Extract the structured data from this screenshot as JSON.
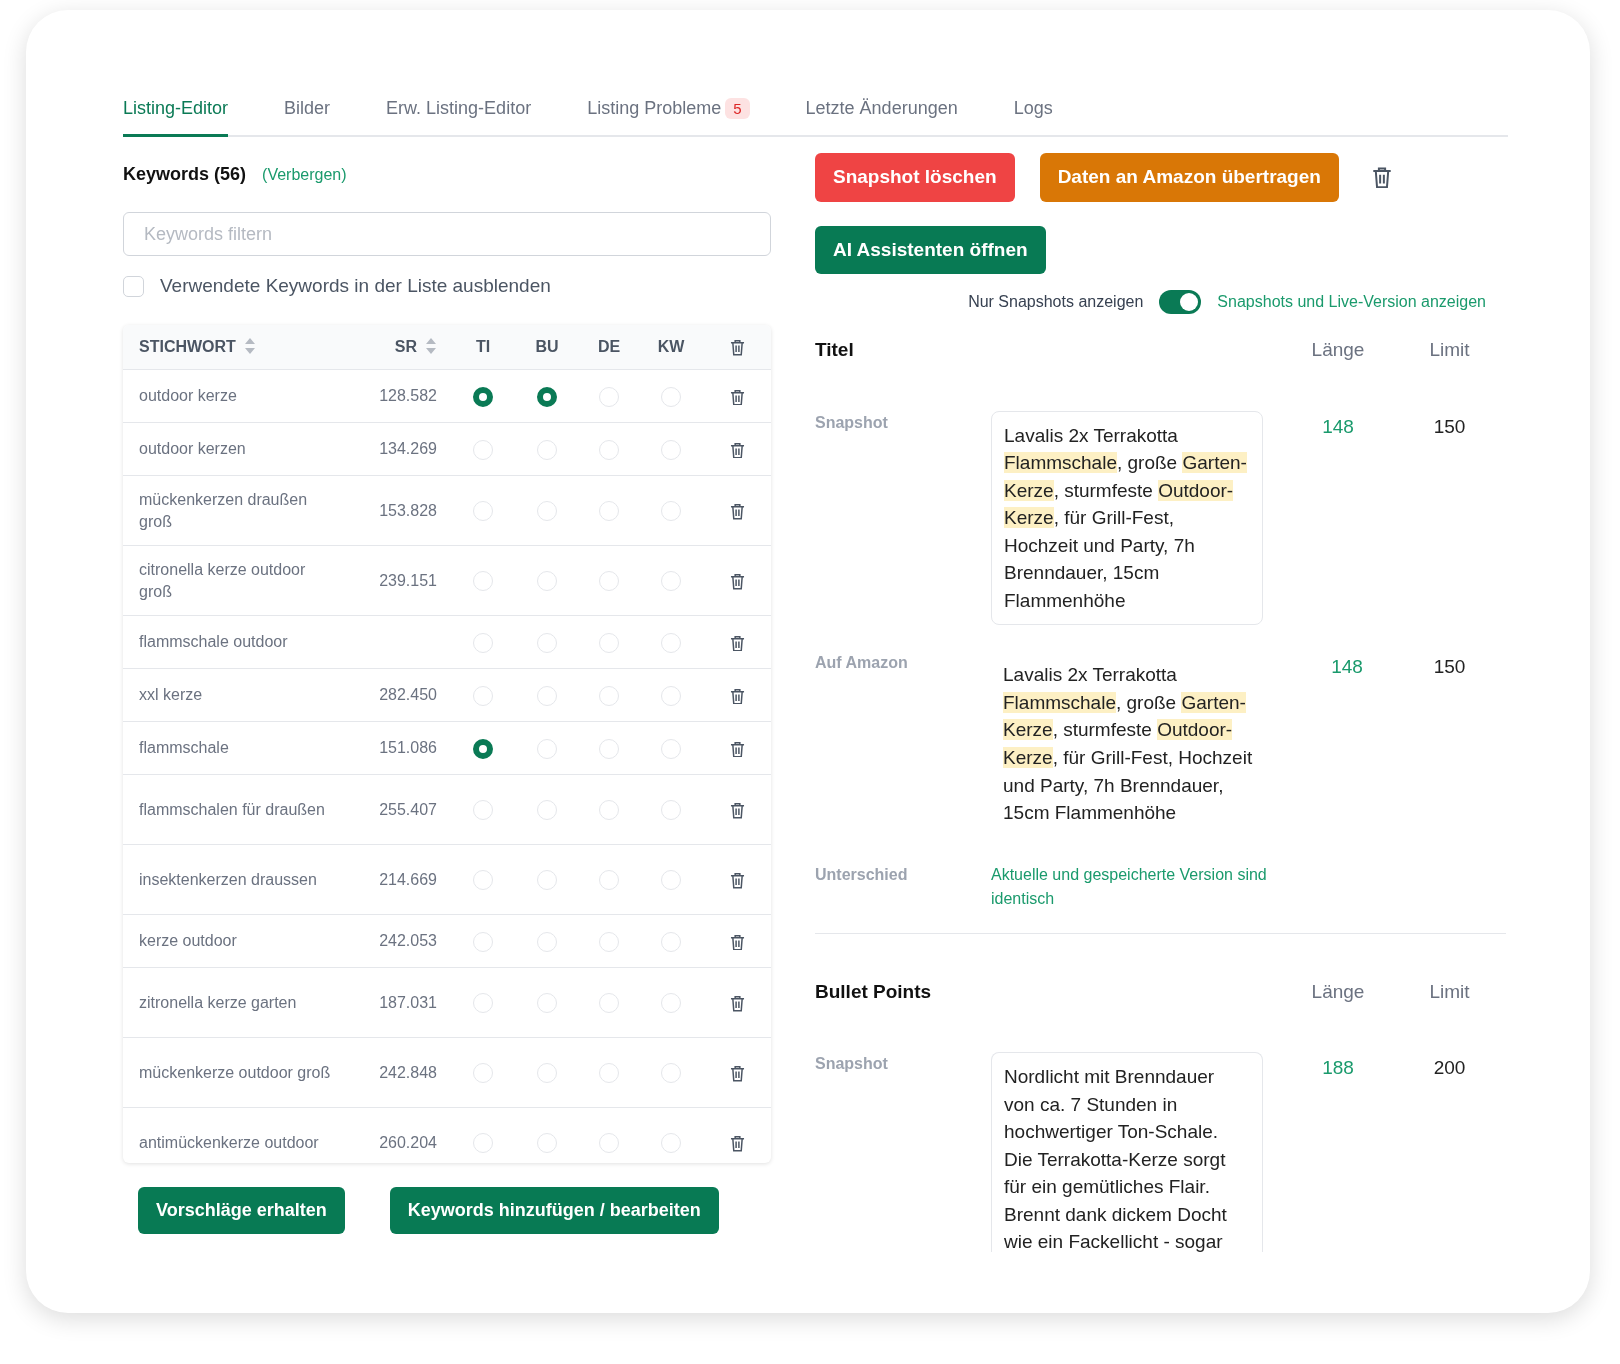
{
  "tabs": [
    {
      "label": "Listing-Editor",
      "selected": true
    },
    {
      "label": "Bilder",
      "selected": false
    },
    {
      "label": "Erw. Listing-Editor",
      "selected": false
    },
    {
      "label": "Listing Probleme",
      "selected": false,
      "badge": "5"
    },
    {
      "label": "Letzte Änderungen",
      "selected": false
    },
    {
      "label": "Logs",
      "selected": false
    }
  ],
  "keywords": {
    "title": "Keywords (56)",
    "hide_link": "(Verbergen)",
    "filter": {
      "placeholder": "Keywords filtern"
    },
    "hide_used": {
      "label": "Verwendete Keywords in der Liste ausblenden",
      "checked": false
    },
    "columns": [
      "STICHWORT",
      "SR",
      "TI",
      "BU",
      "DE",
      "KW"
    ],
    "rows": [
      {
        "keyword": "outdoor kerze",
        "sr": "128.582",
        "ti": true,
        "bu": true,
        "de": false,
        "kw": false
      },
      {
        "keyword": "outdoor kerzen",
        "sr": "134.269",
        "ti": false,
        "bu": false,
        "de": false,
        "kw": false
      },
      {
        "keyword": "mückenkerzen draußen groß",
        "sr": "153.828",
        "ti": false,
        "bu": false,
        "de": false,
        "kw": false
      },
      {
        "keyword": "citronella kerze outdoor groß",
        "sr": "239.151",
        "ti": false,
        "bu": false,
        "de": false,
        "kw": false
      },
      {
        "keyword": "flammschale outdoor",
        "ti": false,
        "bu": false,
        "de": false,
        "kw": false
      },
      {
        "keyword": "xxl kerze",
        "sr": "282.450",
        "ti": false,
        "bu": false,
        "de": false,
        "kw": false
      },
      {
        "keyword": "flammschale",
        "sr": "151.086",
        "ti": true,
        "bu": false,
        "de": false,
        "kw": false
      },
      {
        "keyword": "flammschalen für draußen",
        "sr": "255.407",
        "ti": false,
        "bu": false,
        "de": false,
        "kw": false
      },
      {
        "keyword": "insektenkerzen draussen",
        "sr": "214.669",
        "ti": false,
        "bu": false,
        "de": false,
        "kw": false
      },
      {
        "keyword": "kerze outdoor",
        "sr": "242.053",
        "ti": false,
        "bu": false,
        "de": false,
        "kw": false
      },
      {
        "keyword": "zitronella kerze garten",
        "sr": "187.031",
        "ti": false,
        "bu": false,
        "de": false,
        "kw": false
      },
      {
        "keyword": "mückenkerze outdoor groß",
        "sr": "242.848",
        "ti": false,
        "bu": false,
        "de": false,
        "kw": false
      },
      {
        "keyword": "antimückenkerze outdoor",
        "sr": "260.204",
        "ti": false,
        "bu": false,
        "de": false,
        "kw": false
      }
    ],
    "buttons": [
      "Vorschläge erhalten",
      "Keywords hinzufügen / bearbeiten"
    ]
  },
  "actions": [
    {
      "label": "Snapshot löschen",
      "kind": "danger"
    },
    {
      "label": "Daten an Amazon übertragen",
      "kind": "warning"
    }
  ],
  "ai_button": "AI Assistenten öffnen",
  "view_toggle": {
    "left_label": "Nur Snapshots anzeigen",
    "on": true,
    "right_label": "Snapshots und Live-Version anzeigen"
  },
  "sections": [
    {
      "title": "Titel",
      "length_header": "Länge",
      "limit_header": "Limit",
      "rows": [
        {
          "label": "Snapshot",
          "kind": "boxed",
          "segments": [
            {
              "text": "Lavalis 2x Terrakotta ",
              "highlight": false
            },
            {
              "text": "Flammschale",
              "highlight": true
            },
            {
              "text": ", große ",
              "highlight": false
            },
            {
              "text": "Garten-Kerze",
              "highlight": true
            },
            {
              "text": ", sturmfeste ",
              "highlight": false
            },
            {
              "text": "Outdoor-Kerze",
              "highlight": true
            },
            {
              "text": ", für Grill-Fest, Hochzeit und Party, 7h Brenndauer, 15cm Flammenhöhe",
              "highlight": false
            }
          ],
          "length": "148",
          "limit": "150"
        },
        {
          "label": "Auf Amazon",
          "kind": "plain",
          "segments": [
            {
              "text": "Lavalis 2x Terrakotta ",
              "highlight": false
            },
            {
              "text": "Flammschale",
              "highlight": true
            },
            {
              "text": ", große ",
              "highlight": false
            },
            {
              "text": "Garten-Kerze",
              "highlight": true
            },
            {
              "text": ", sturmfeste ",
              "highlight": false
            },
            {
              "text": "Outdoor-Kerze",
              "highlight": true
            },
            {
              "text": ", für Grill-Fest, Hochzeit und Party, 7h Brenndauer, 15cm Flammenhöhe",
              "highlight": false
            }
          ],
          "length": "148",
          "limit": "150"
        },
        {
          "label": "Unterschied",
          "kind": "note",
          "note": "Aktuelle und gespeicherte Version sind identisch"
        }
      ]
    },
    {
      "title": "Bullet Points",
      "length_header": "Länge",
      "limit_header": "Limit",
      "rows": [
        {
          "label": "Snapshot",
          "kind": "boxed",
          "segments": [
            {
              "text": "Nordlicht mit Brenndauer von ca. 7 Stunden in hochwertiger Ton-Schale. Die Terrakotta-Kerze sorgt für ein gemütliches Flair. Brennt dank dickem Docht wie ein Fackellicht - sogar",
              "highlight": false
            }
          ],
          "length": "188",
          "limit": "200"
        }
      ]
    }
  ]
}
